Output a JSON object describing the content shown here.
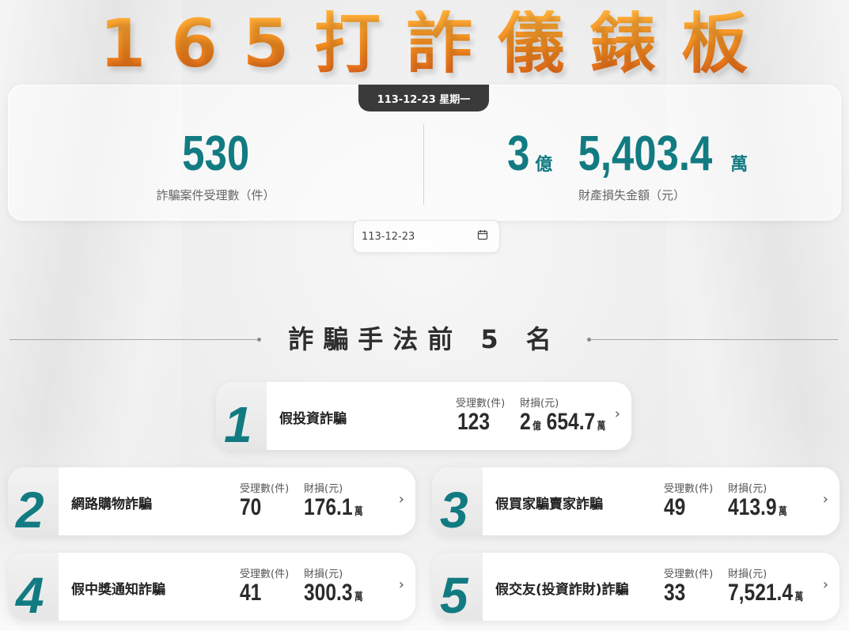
{
  "title_chars": [
    "1",
    "6",
    "5",
    "打",
    "詐",
    "儀",
    "錶",
    "板"
  ],
  "date_badge": "113-12-23 星期一",
  "summary": {
    "cases": {
      "value": "530",
      "label": "詐騙案件受理數（件）"
    },
    "loss": {
      "yi": "3",
      "yi_unit": "億",
      "wan": "5,403.4",
      "wan_unit": "萬",
      "label": "財產損失金額（元）"
    }
  },
  "date_input": {
    "value": "113-12-23",
    "icon": "calendar-icon"
  },
  "section_title": "詐騙手法前 5 名",
  "col_headers": {
    "cases": "受理數(件)",
    "loss": "財損(元)"
  },
  "top5": [
    {
      "rank": "1",
      "name": "假投資詐騙",
      "cases": "123",
      "loss_yi": "2",
      "loss_yi_unit": "億",
      "loss_wan": "654.7",
      "loss_wan_unit": "萬"
    },
    {
      "rank": "2",
      "name": "網路購物詐騙",
      "cases": "70",
      "loss_wan": "176.1",
      "loss_wan_unit": "萬"
    },
    {
      "rank": "3",
      "name": "假買家騙賣家詐騙",
      "cases": "49",
      "loss_wan": "413.9",
      "loss_wan_unit": "萬"
    },
    {
      "rank": "4",
      "name": "假中獎通知詐騙",
      "cases": "41",
      "loss_wan": "300.3",
      "loss_wan_unit": "萬"
    },
    {
      "rank": "5",
      "name": "假交友(投資詐財)詐騙",
      "cases": "33",
      "loss_wan": "7,521.4",
      "loss_wan_unit": "萬"
    }
  ],
  "colors": {
    "accent": "#127b82",
    "title_orange": "#f28a1e",
    "badge": "#3a3a3a"
  }
}
